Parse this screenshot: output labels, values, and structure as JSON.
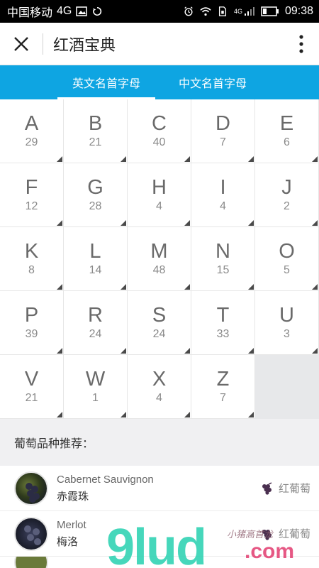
{
  "status_bar": {
    "carrier": "中国移动",
    "network": "4G",
    "network_small": "4G",
    "time": "09:38"
  },
  "app_bar": {
    "title": "红酒宝典",
    "close_icon": "close-icon",
    "more_icon": "more-vertical-icon"
  },
  "tabs": [
    {
      "label": "英文名首字母",
      "active": true
    },
    {
      "label": "中文名首字母",
      "active": false
    }
  ],
  "letters": [
    {
      "letter": "A",
      "count": "29"
    },
    {
      "letter": "B",
      "count": "21"
    },
    {
      "letter": "C",
      "count": "40"
    },
    {
      "letter": "D",
      "count": "7"
    },
    {
      "letter": "E",
      "count": "6"
    },
    {
      "letter": "F",
      "count": "12"
    },
    {
      "letter": "G",
      "count": "28"
    },
    {
      "letter": "H",
      "count": "4"
    },
    {
      "letter": "I",
      "count": "4"
    },
    {
      "letter": "J",
      "count": "2"
    },
    {
      "letter": "K",
      "count": "8"
    },
    {
      "letter": "L",
      "count": "14"
    },
    {
      "letter": "M",
      "count": "48"
    },
    {
      "letter": "N",
      "count": "15"
    },
    {
      "letter": "O",
      "count": "5"
    },
    {
      "letter": "P",
      "count": "39"
    },
    {
      "letter": "R",
      "count": "24"
    },
    {
      "letter": "S",
      "count": "24"
    },
    {
      "letter": "T",
      "count": "33"
    },
    {
      "letter": "U",
      "count": "3"
    },
    {
      "letter": "V",
      "count": "21"
    },
    {
      "letter": "W",
      "count": "1"
    },
    {
      "letter": "X",
      "count": "4"
    },
    {
      "letter": "Z",
      "count": "7"
    }
  ],
  "recommend_title": "葡萄品种推荐：",
  "varieties": [
    {
      "name_en": "Cabernet Sauvignon",
      "name_cn": "赤霞珠",
      "tag": "红葡萄",
      "tag_icon": "grape-icon"
    },
    {
      "name_en": "Merlot",
      "name_cn": "梅洛",
      "tag": "红葡萄",
      "tag_icon": "grape-icon"
    }
  ],
  "watermark": {
    "brand": "9lud",
    "domain": ".com",
    "slogan": "小猪高首龙"
  },
  "colors": {
    "tab_bar": "#0ea5e2",
    "watermark_green": "#26d1b0",
    "watermark_pink": "#e23b6f"
  }
}
